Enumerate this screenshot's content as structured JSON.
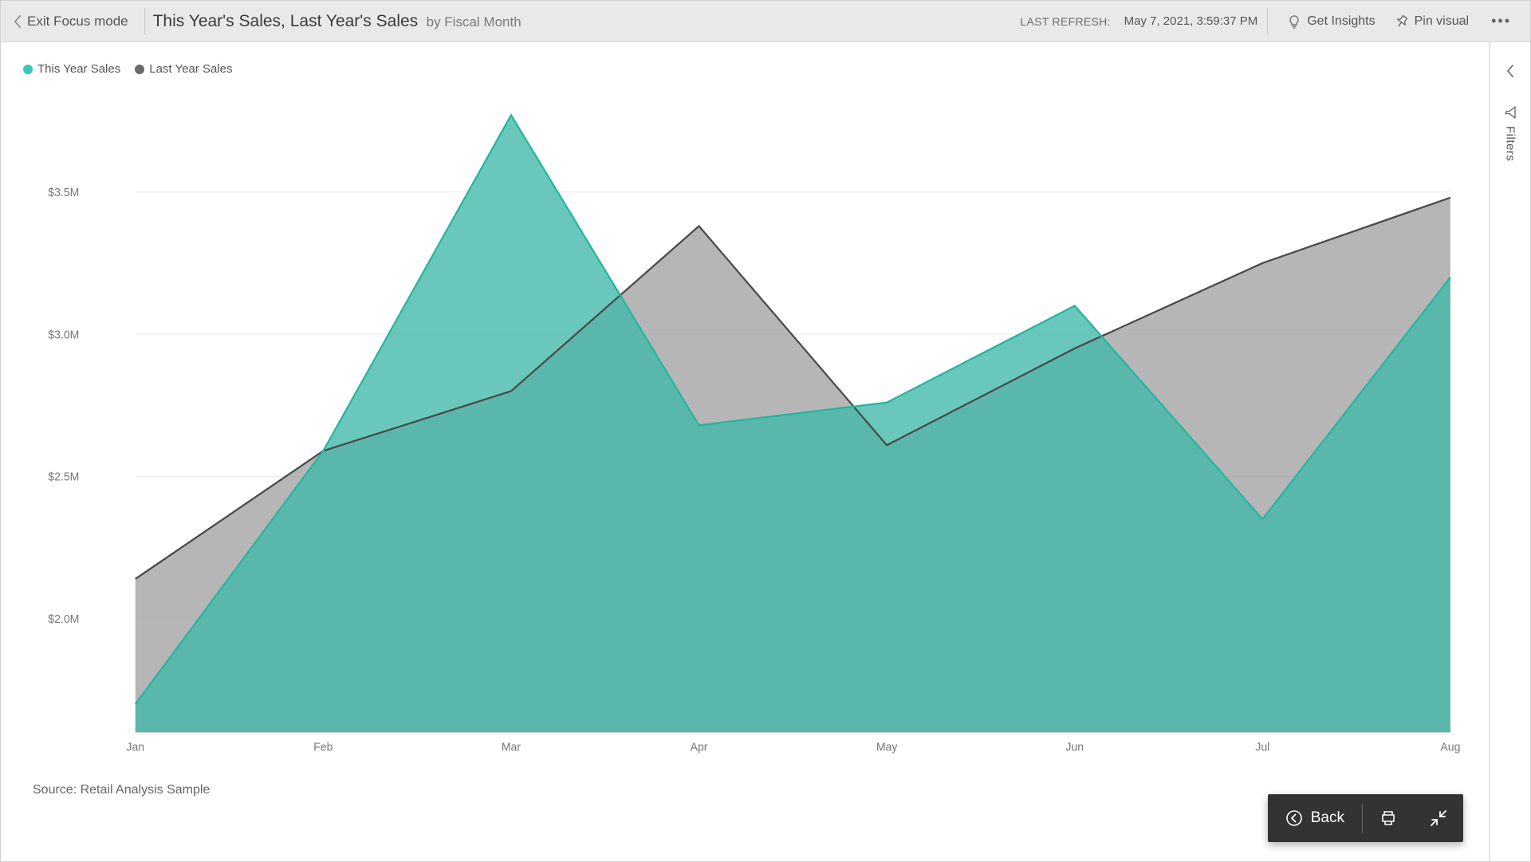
{
  "topbar": {
    "exit_label": "Exit Focus mode",
    "title_main": "This Year's Sales, Last Year's Sales",
    "title_sub": "by Fiscal Month",
    "refresh_label": "LAST REFRESH:",
    "refresh_date": "May 7, 2021, 3:59:37 PM",
    "get_insights": "Get Insights",
    "pin_visual": "Pin visual"
  },
  "side": {
    "filters_label": "Filters"
  },
  "legend": {
    "this_year": "This Year Sales",
    "last_year": "Last Year Sales"
  },
  "source_text": "Source: Retail Analysis Sample",
  "actionbar": {
    "back": "Back"
  },
  "colors": {
    "teal": "#36c9b4",
    "gray": "#6a6a6a"
  },
  "chart_data": {
    "type": "area",
    "xlabel": "",
    "ylabel": "",
    "categories": [
      "Jan",
      "Feb",
      "Mar",
      "Apr",
      "May",
      "Jun",
      "Jul",
      "Aug"
    ],
    "series": [
      {
        "name": "This Year Sales",
        "color": "#36c9b4",
        "values": [
          1700000,
          2590000,
          3770000,
          2680000,
          2760000,
          3100000,
          2350000,
          3200000
        ]
      },
      {
        "name": "Last Year Sales",
        "color": "#6a6a6a",
        "values": [
          2140000,
          2590000,
          2800000,
          3380000,
          2610000,
          2950000,
          3250000,
          3480000
        ]
      }
    ],
    "y_ticks": [
      2000000,
      2500000,
      3000000,
      3500000
    ],
    "y_tick_labels": [
      "$2.0M",
      "$2.5M",
      "$3.0M",
      "$3.5M"
    ],
    "y_baseline": 1600000,
    "ylim": [
      1600000,
      3800000
    ]
  }
}
